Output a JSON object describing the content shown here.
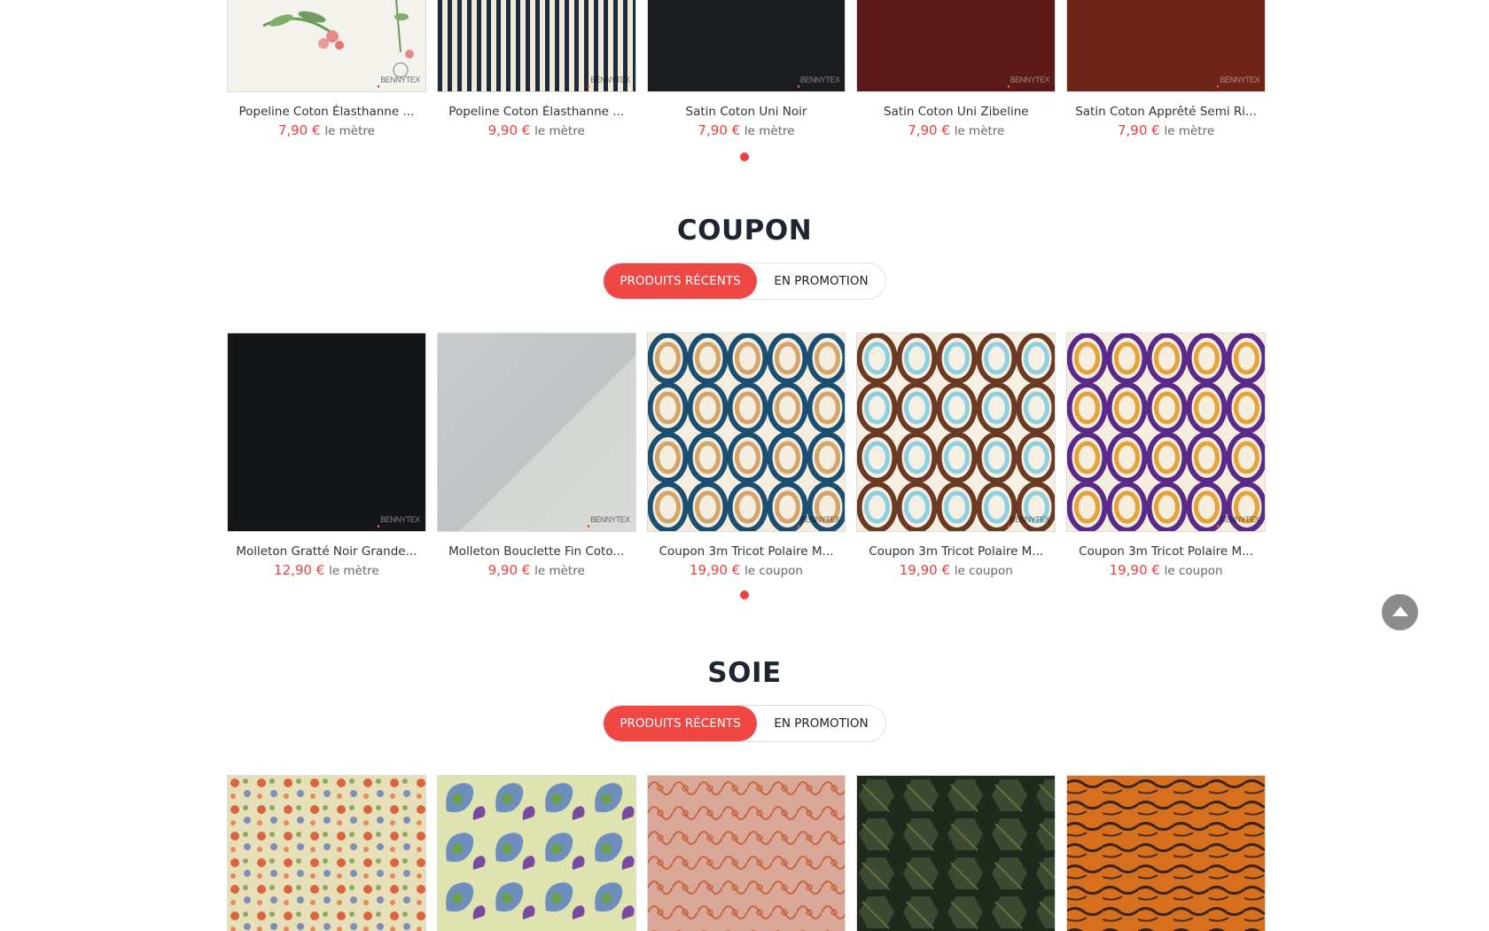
{
  "section1": {
    "products": [
      {
        "name": "Popeline Coton Élasthanne ...",
        "price": "7,90 €",
        "unit": "le mètre",
        "watermark": "BENNYTEX"
      },
      {
        "name": "Popeline Coton Élasthanne ...",
        "price": "9,90 €",
        "unit": "le mètre",
        "watermark": "BENNYTEX"
      },
      {
        "name": "Satin Coton Uni Noir",
        "price": "7,90 €",
        "unit": "le mètre",
        "watermark": "BENNYTEX"
      },
      {
        "name": "Satin Coton Uni Zibeline",
        "price": "7,90 €",
        "unit": "le mètre",
        "watermark": "BENNYTEX"
      },
      {
        "name": "Satin Coton Apprêté Semi Ri...",
        "price": "7,90 €",
        "unit": "le mètre",
        "watermark": "BENNYTEX"
      }
    ]
  },
  "coupon": {
    "title": "COUPON",
    "tab_recent": "PRODUITS RÉCENTS",
    "tab_promo": "EN PROMOTION",
    "products": [
      {
        "name": "Molleton Gratté Noir Grande...",
        "price": "12,90 €",
        "unit": "le mètre",
        "watermark": "BENNYTEX"
      },
      {
        "name": "Molleton Bouclette Fin Coto...",
        "price": "9,90 €",
        "unit": "le mètre",
        "watermark": "BENNYTEX"
      },
      {
        "name": "Coupon 3m Tricot Polaire M...",
        "price": "19,90 €",
        "unit": "le coupon",
        "watermark": "BENNYTEX"
      },
      {
        "name": "Coupon 3m Tricot Polaire M...",
        "price": "19,90 €",
        "unit": "le coupon",
        "watermark": "BENNYTEX"
      },
      {
        "name": "Coupon 3m Tricot Polaire M...",
        "price": "19,90 €",
        "unit": "le coupon",
        "watermark": "BENNYTEX"
      }
    ]
  },
  "soie": {
    "title": "SOIE",
    "tab_recent": "PRODUITS RÉCENTS",
    "tab_promo": "EN PROMOTION"
  },
  "colors": {
    "accent": "#ef4744",
    "price": "#e8413e",
    "title": "#1f2530"
  }
}
